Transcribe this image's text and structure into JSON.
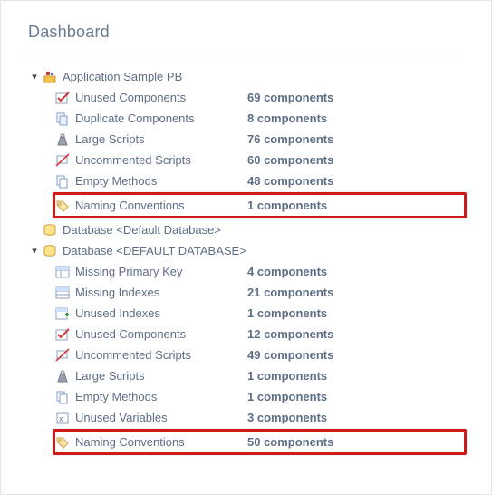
{
  "page_title": "Dashboard",
  "tree": [
    {
      "label": "Application Sample PB",
      "icon": "app-icon",
      "expanded": true,
      "children": [
        {
          "label": "Unused Components",
          "icon": "check-red-icon",
          "count": "69 components",
          "highlight": false
        },
        {
          "label": "Duplicate Components",
          "icon": "copy-icon",
          "count": "8 components",
          "highlight": false
        },
        {
          "label": "Large Scripts",
          "icon": "weight-icon",
          "count": "76 components",
          "highlight": false
        },
        {
          "label": "Uncommented Scripts",
          "icon": "comment-off-icon",
          "count": "60 components",
          "highlight": false
        },
        {
          "label": "Empty Methods",
          "icon": "empty-box-icon",
          "count": "48 components",
          "highlight": false
        },
        {
          "label": "Naming Conventions",
          "icon": "tag-icon",
          "count": "1 components",
          "highlight": true
        }
      ]
    },
    {
      "label": "Database <Default Database>",
      "icon": "db-icon",
      "expanded": false,
      "children": []
    },
    {
      "label": "Database <DEFAULT DATABASE>",
      "icon": "db-icon",
      "expanded": true,
      "children": [
        {
          "label": "Missing Primary Key",
          "icon": "table-key-icon",
          "count": "4 components",
          "highlight": false
        },
        {
          "label": "Missing Indexes",
          "icon": "table-idx-icon",
          "count": "21 components",
          "highlight": false
        },
        {
          "label": "Unused Indexes",
          "icon": "table-plus-icon",
          "count": "1 components",
          "highlight": false
        },
        {
          "label": "Unused Components",
          "icon": "check-red-icon",
          "count": "12 components",
          "highlight": false
        },
        {
          "label": "Uncommented Scripts",
          "icon": "comment-off-icon",
          "count": "49 components",
          "highlight": false
        },
        {
          "label": "Large Scripts",
          "icon": "weight-icon",
          "count": "1 components",
          "highlight": false
        },
        {
          "label": "Empty Methods",
          "icon": "empty-box-icon",
          "count": "1 components",
          "highlight": false
        },
        {
          "label": "Unused Variables",
          "icon": "var-icon",
          "count": "3 components",
          "highlight": false
        },
        {
          "label": "Naming Conventions",
          "icon": "tag-icon",
          "count": "50 components",
          "highlight": true
        }
      ]
    }
  ]
}
